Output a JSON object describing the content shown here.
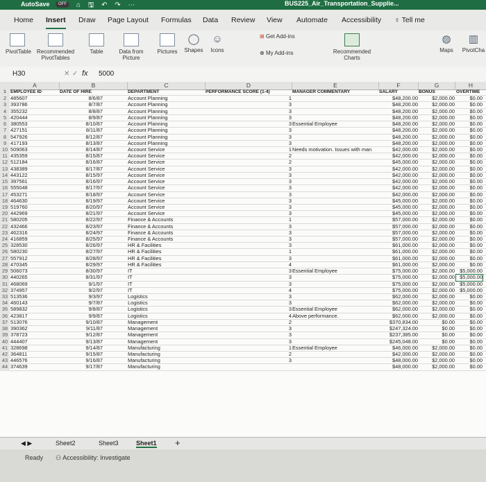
{
  "titlebar": {
    "autosave": "AutoSave",
    "toggle": "OFF",
    "doc_title": "BUS225_Air_Transportation_Supplie..."
  },
  "menu": [
    "Home",
    "Insert",
    "Draw",
    "Page Layout",
    "Formulas",
    "Data",
    "Review",
    "View",
    "Automate",
    "Accessibility",
    "Tell me"
  ],
  "ribbon": {
    "pivottable": "PivotTable",
    "recommended_pivot": "Recommended PivotTables",
    "table": "Table",
    "data_from_picture": "Data from Picture",
    "pictures": "Pictures",
    "shapes": "Shapes",
    "icons": "Icons",
    "get_addins": "Get Add-ins",
    "my_addins": "My Add-ins",
    "recommended_charts": "Recommended Charts",
    "maps": "Maps",
    "pivotchart": "PivotCha"
  },
  "formula_bar": {
    "cell_ref": "H30",
    "fx": "fx",
    "value": "5000"
  },
  "columns": [
    "A",
    "B",
    "C",
    "D",
    "E",
    "F",
    "G",
    "H"
  ],
  "headers": [
    "EMPLOYEE ID",
    "DATE OF HIRE",
    "DEPARTMENT",
    "PERFORMANCE SCORE (1-4)",
    "MANAGER COMMENTARY",
    "SALARY",
    "BONUS",
    "OVERTIME"
  ],
  "rows": [
    [
      "2",
      "485607",
      "8/6/87",
      "Account Planning",
      "1",
      "",
      "$48,200.00",
      "$2,000.00",
      "$0.00"
    ],
    [
      "3",
      "393786",
      "8/7/87",
      "Account Planning",
      "3",
      "",
      "$48,200.00",
      "$2,000.00",
      "$0.00"
    ],
    [
      "4",
      "355232",
      "8/8/87",
      "Account Planning",
      "3",
      "",
      "$48,200.00",
      "$2,000.00",
      "$0.00"
    ],
    [
      "5",
      "420444",
      "8/9/87",
      "Account Planning",
      "3",
      "",
      "$48,200.00",
      "$2,000.00",
      "$0.00"
    ],
    [
      "6",
      "380553",
      "8/10/87",
      "Account Planning",
      "3",
      "Essential Employee",
      "$48,200.00",
      "$2,000.00",
      "$0.00"
    ],
    [
      "7",
      "427151",
      "8/11/87",
      "Account Planning",
      "3",
      "",
      "$48,200.00",
      "$2,000.00",
      "$0.00"
    ],
    [
      "8",
      "547926",
      "8/12/87",
      "Account Planning",
      "3",
      "",
      "$48,200.00",
      "$2,000.00",
      "$0.00"
    ],
    [
      "9",
      "417193",
      "8/13/87",
      "Account Planning",
      "3",
      "",
      "$48,200.00",
      "$2,000.00",
      "$0.00"
    ],
    [
      "10",
      "509063",
      "8/14/87",
      "Account Service",
      "1",
      "Needs motivation. Issues with man",
      "$42,000.00",
      "$2,000.00",
      "$0.00"
    ],
    [
      "11",
      "435359",
      "8/15/87",
      "Account Service",
      "2",
      "",
      "$42,000.00",
      "$2,000.00",
      "$0.00"
    ],
    [
      "12",
      "512184",
      "8/16/87",
      "Account Service",
      "2",
      "",
      "$45,000.00",
      "$2,000.00",
      "$0.00"
    ],
    [
      "13",
      "438389",
      "8/17/87",
      "Account Service",
      "3",
      "",
      "$42,000.00",
      "$2,000.00",
      "$0.00"
    ],
    [
      "14",
      "443122",
      "8/15/97",
      "Account Service",
      "3",
      "",
      "$42,000.00",
      "$2,000.00",
      "$0.00"
    ],
    [
      "15",
      "397561",
      "8/16/97",
      "Account Service",
      "3",
      "",
      "$42,000.00",
      "$2,000.00",
      "$0.00"
    ],
    [
      "16",
      "555048",
      "8/17/97",
      "Account Service",
      "3",
      "",
      "$42,000.00",
      "$2,000.00",
      "$0.00"
    ],
    [
      "17",
      "453271",
      "8/18/97",
      "Account Service",
      "3",
      "",
      "$42,000.00",
      "$2,000.00",
      "$0.00"
    ],
    [
      "18",
      "464630",
      "8/19/97",
      "Account Service",
      "3",
      "",
      "$45,000.00",
      "$2,000.00",
      "$0.00"
    ],
    [
      "19",
      "519760",
      "8/20/97",
      "Account Service",
      "3",
      "",
      "$45,000.00",
      "$2,000.00",
      "$0.00"
    ],
    [
      "20",
      "442969",
      "8/21/97",
      "Account Service",
      "3",
      "",
      "$45,000.00",
      "$2,000.00",
      "$0.00"
    ],
    [
      "21",
      "580205",
      "8/22/97",
      "Finance & Accounts",
      "1",
      "",
      "$57,000.00",
      "$2,000.00",
      "$0.00"
    ],
    [
      "22",
      "432466",
      "8/23/97",
      "Finance & Accounts",
      "3",
      "",
      "$57,000.00",
      "$2,000.00",
      "$0.00"
    ],
    [
      "23",
      "462316",
      "8/24/97",
      "Finance & Accounts",
      "3",
      "",
      "$57,000.00",
      "$2,000.00",
      "$0.00"
    ],
    [
      "24",
      "416859",
      "8/25/97",
      "Finance & Accounts",
      "3",
      "",
      "$57,000.00",
      "$2,000.00",
      "$0.00"
    ],
    [
      "25",
      "328530",
      "8/26/97",
      "HR & Facilities",
      "3",
      "",
      "$61,000.00",
      "$2,000.00",
      "$0.00"
    ],
    [
      "26",
      "580230",
      "8/27/97",
      "HR & Facilities",
      "1",
      "",
      "$61,000.00",
      "$2,000.00",
      "$0.00"
    ],
    [
      "27",
      "557912",
      "8/28/97",
      "HR & Facilities",
      "3",
      "",
      "$61,000.00",
      "$2,000.00",
      "$0.00"
    ],
    [
      "28",
      "470345",
      "8/29/97",
      "HR & Facilities",
      "4",
      "",
      "$61,000.00",
      "$2,000.00",
      "$0.00"
    ],
    [
      "29",
      "506073",
      "8/30/97",
      "IT",
      "3",
      "Essential Employee",
      "$75,000.00",
      "$2,000.00",
      "$5,000.00"
    ],
    [
      "30",
      "440265",
      "8/31/97",
      "IT",
      "3",
      "",
      "$75,000.00",
      "$2,000.00",
      "$5,000.00"
    ],
    [
      "31",
      "468069",
      "9/1/97",
      "IT",
      "3",
      "",
      "$75,000.00",
      "$2,000.00",
      "$5,000.00"
    ],
    [
      "32",
      "374957",
      "9/2/97",
      "IT",
      "4",
      "",
      "$75,000.00",
      "$2,000.00",
      "$5,000.00"
    ],
    [
      "33",
      "513536",
      "9/3/97",
      "Logistics",
      "3",
      "",
      "$62,000.00",
      "$2,000.00",
      "$0.00"
    ],
    [
      "34",
      "460143",
      "9/7/87",
      "Logistics",
      "3",
      "",
      "$62,000.00",
      "$2,000.00",
      "$0.00"
    ],
    [
      "35",
      "589832",
      "9/8/87",
      "Logistics",
      "3",
      "Essential Employee",
      "$62,000.00",
      "$2,000.00",
      "$0.00"
    ],
    [
      "36",
      "423817",
      "9/9/87",
      "Logistics",
      "4",
      "Above performance.",
      "$62,000.00",
      "$2,000.00",
      "$0.00"
    ],
    [
      "37",
      "513076",
      "9/10/87",
      "Management",
      "2",
      "",
      "$370,834.00",
      "$0.00",
      "$0.00"
    ],
    [
      "38",
      "390362",
      "9/11/87",
      "Management",
      "3",
      "",
      "$247,324.00",
      "$0.00",
      "$0.00"
    ],
    [
      "39",
      "378723",
      "9/12/87",
      "Management",
      "3",
      "",
      "$237,385.00",
      "$0.00",
      "$0.00"
    ],
    [
      "40",
      "444407",
      "9/13/87",
      "Management",
      "3",
      "",
      "$245,048.00",
      "$0.00",
      "$0.00"
    ],
    [
      "41",
      "328698",
      "9/14/87",
      "Manufacturing",
      "1",
      "Essential Employee",
      "$46,000.00",
      "$2,000.00",
      "$0.00"
    ],
    [
      "42",
      "364811",
      "9/15/87",
      "Manufacturing",
      "2",
      "",
      "$42,000.00",
      "$2,000.00",
      "$0.00"
    ],
    [
      "43",
      "446576",
      "9/16/87",
      "Manufacturing",
      "3",
      "",
      "$48,000.00",
      "$2,000.00",
      "$0.00"
    ],
    [
      "44",
      "374639",
      "9/17/87",
      "Manufacturing",
      "",
      "",
      "$48,000.00",
      "$2,000.00",
      "$0.00"
    ]
  ],
  "sheets": [
    "Sheet2",
    "Sheet3",
    "Sheet1"
  ],
  "active_sheet": "Sheet1",
  "status": {
    "ready": "Ready",
    "accessibility": "Accessibility: Investigate"
  },
  "colors": {
    "accent": "#1f7244",
    "titlebar": "#1f6e43"
  }
}
